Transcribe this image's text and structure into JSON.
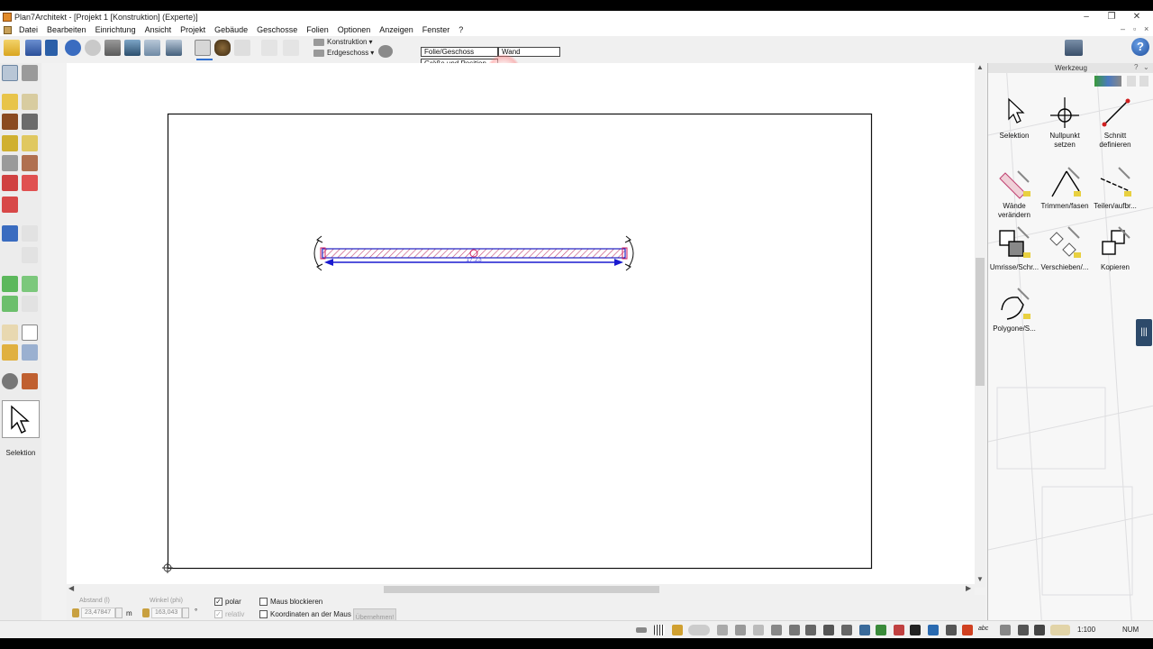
{
  "window": {
    "title": "Plan7Architekt - [Projekt 1 [Konstruktion] (Experte)]",
    "minimize": "–",
    "restore": "❐",
    "close": "✕"
  },
  "menu": [
    "Datei",
    "Bearbeiten",
    "Einrichtung",
    "Ansicht",
    "Projekt",
    "Gebäude",
    "Geschosse",
    "Folien",
    "Optionen",
    "Anzeigen",
    "Fenster",
    "?"
  ],
  "toolbar": {
    "construction_dropdown": "Konstruktion",
    "floor_dropdown": "Erdgeschoss",
    "layer_floor_label": "Folie/Geschoss",
    "wall_label": "Wand",
    "size_position_label": "Größe und Position",
    "help_label": "?"
  },
  "canvas": {
    "wall_dimension": "17,23"
  },
  "left_toolbox": {
    "active_tool_label": "Selektion"
  },
  "right_panel": {
    "title": "Werkzeug",
    "tools": [
      {
        "label": "Selektion"
      },
      {
        "label": "Nullpunkt setzen"
      },
      {
        "label": "Schnitt definieren"
      },
      {
        "label": "Wände verändern"
      },
      {
        "label": "Trimmen/fasen"
      },
      {
        "label": "Teilen/aufbr..."
      },
      {
        "label": "Umrisse/Schr..."
      },
      {
        "label": "Verschieben/..."
      },
      {
        "label": "Kopieren"
      },
      {
        "label": "Polygone/S..."
      }
    ]
  },
  "input_bar": {
    "distance_label": "Abstand (l)",
    "distance_value": "23,47847",
    "distance_unit": "m",
    "angle_label": "Winkel (phi)",
    "angle_value": "163,043",
    "angle_unit": "°",
    "polar_label": "polar",
    "polar_checked": true,
    "relative_label": "relativ",
    "relative_checked": true,
    "block_mouse_label": "Maus blockieren",
    "coords_at_mouse_label": "Koordinaten an der Maus",
    "apply_label": "Übernehmen!"
  },
  "status_bar": {
    "scale": "1:100",
    "num": "NUM"
  }
}
